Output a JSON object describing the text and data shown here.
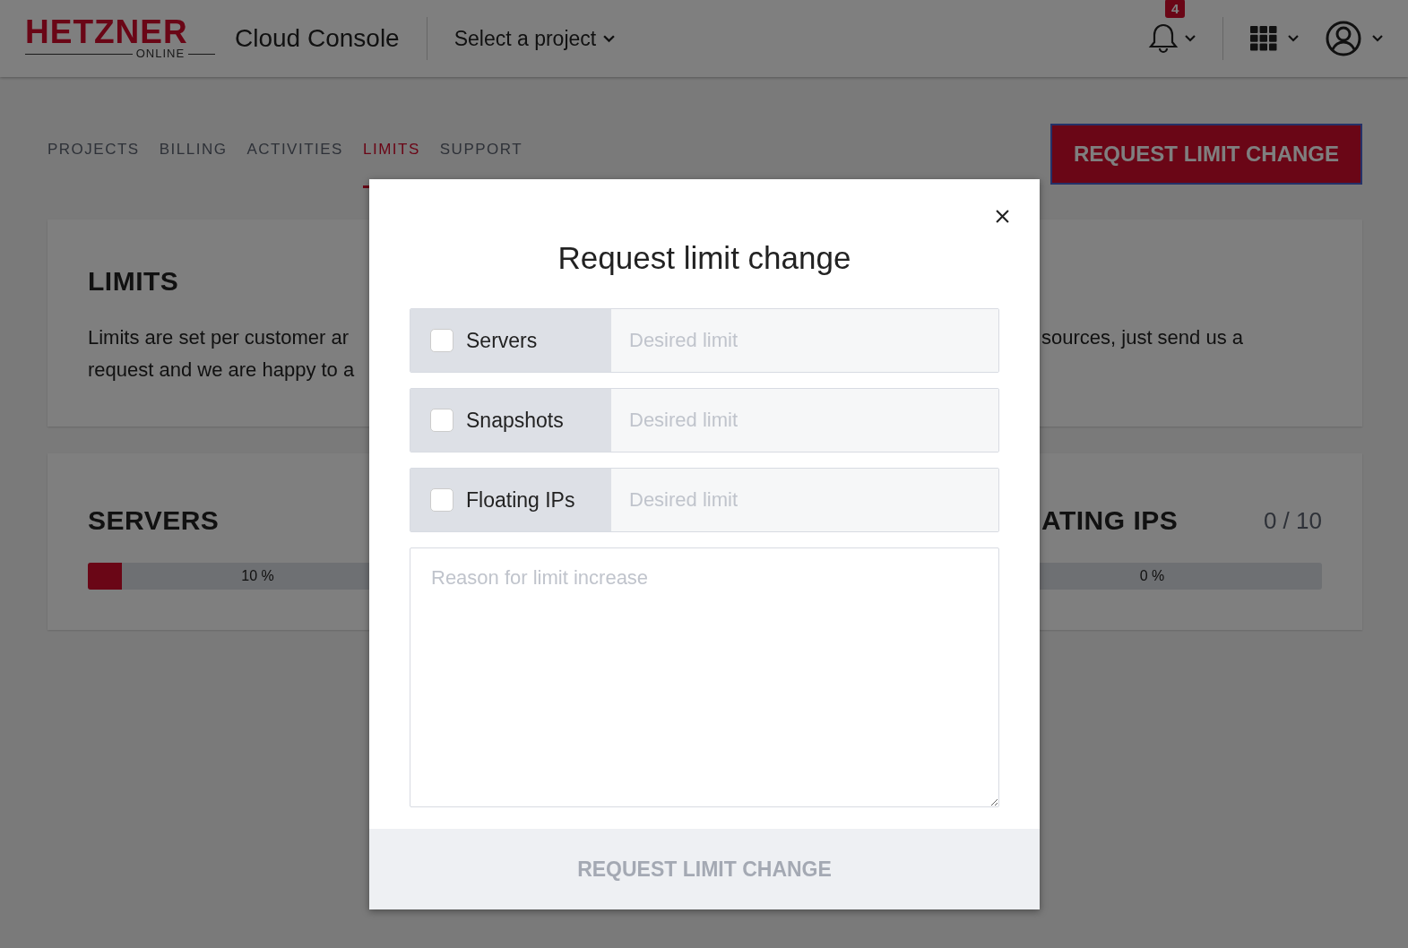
{
  "header": {
    "logo": {
      "brand": "HETZNER",
      "sub": "ONLINE"
    },
    "app_title": "Cloud Console",
    "project_selector": "Select a project",
    "notifications": {
      "count": "4"
    }
  },
  "tabs": [
    {
      "label": "PROJECTS",
      "selected": false
    },
    {
      "label": "BILLING",
      "selected": false
    },
    {
      "label": "ACTIVITIES",
      "selected": false
    },
    {
      "label": "LIMITS",
      "selected": true
    },
    {
      "label": "SUPPORT",
      "selected": false
    }
  ],
  "request_button": "REQUEST LIMIT CHANGE",
  "limits_card": {
    "title": "LIMITS",
    "text_left": [
      "Limits are set per customer ar",
      "request and we are happy to a"
    ],
    "text_right": [
      "sources, just send us a"
    ]
  },
  "resources": [
    {
      "title": "SERVERS",
      "level": 0.1,
      "percent": "10 %"
    },
    {
      "title": "ATING IPS",
      "count": "0 / 10",
      "percent": "0 %"
    }
  ],
  "modal": {
    "title": "Request limit change",
    "options": [
      {
        "label": "Servers",
        "checked": false,
        "placeholder": "Desired limit"
      },
      {
        "label": "Snapshots",
        "checked": false,
        "placeholder": "Desired limit"
      },
      {
        "label": "Floating IPs",
        "checked": false,
        "placeholder": "Desired limit"
      }
    ],
    "reason": {
      "placeholder": "Reason for limit increase"
    },
    "submit": {
      "label": "REQUEST LIMIT CHANGE",
      "disabled": true
    }
  }
}
